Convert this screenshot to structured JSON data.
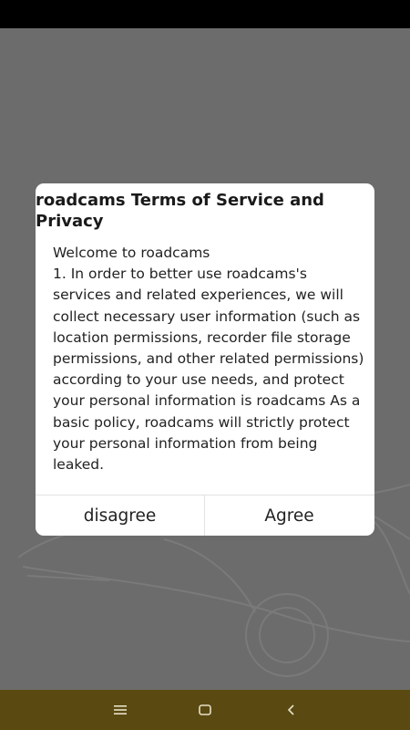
{
  "dialog": {
    "title": "roadcams Terms of Service and Privacy",
    "body": "Welcome to roadcams\n1. In order to better use roadcams's services and related experiences, we will collect necessary user information (such as location permissions, recorder file storage permissions, and other related permissions) according to your use needs, and protect your personal information is roadcams As a basic policy, roadcams will strictly protect your personal information from being leaked.",
    "disagree_label": "disagree",
    "agree_label": "Agree"
  },
  "nav": {
    "menu_icon": "menu-icon",
    "home_icon": "home-icon",
    "back_icon": "back-icon"
  },
  "colors": {
    "overlay": "#6c6c6c",
    "nav_bar": "#5a4a11",
    "status_bar": "#000000"
  }
}
